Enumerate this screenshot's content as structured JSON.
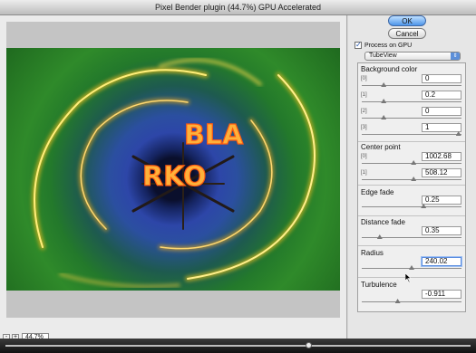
{
  "window": {
    "title": "Pixel Bender plugin (44.7%) GPU Accelerated"
  },
  "buttons": {
    "ok": "OK",
    "cancel": "Cancel"
  },
  "process_on_gpu": {
    "label": "Process on GPU",
    "checked": true
  },
  "filter_select": {
    "value": "TubeView"
  },
  "zoom": {
    "value": "44.7%",
    "minus": "-",
    "plus": "+"
  },
  "preview": {
    "sign_letters_top": "BLA",
    "sign_letters_bottom": "RKO"
  },
  "params": {
    "background_color": {
      "label": "Background color",
      "channels": [
        {
          "index": "[0]",
          "value": "0",
          "level": 0.22
        },
        {
          "index": "[1]",
          "value": "0.2",
          "level": 0.22
        },
        {
          "index": "[2]",
          "value": "0",
          "level": 0.22
        },
        {
          "index": "[3]",
          "value": "1",
          "level": 0.97
        }
      ]
    },
    "center_point": {
      "label": "Center point",
      "channels": [
        {
          "index": "[0]",
          "value": "1002.68",
          "level": 0.52
        },
        {
          "index": "[1]",
          "value": "508.12",
          "level": 0.52
        }
      ]
    },
    "edge_fade": {
      "label": "Edge fade",
      "value": "0.25",
      "level": 0.62
    },
    "distance_fade": {
      "label": "Distance fade",
      "value": "0.35",
      "level": 0.18
    },
    "radius": {
      "label": "Radius",
      "value": "240.02",
      "level": 0.5
    },
    "turbulence": {
      "label": "Turbulence",
      "value": "-0.911",
      "level": 0.36
    }
  },
  "colors": {
    "accent": "#4d95ea",
    "preview_green": "#2f8a2a",
    "preview_blue": "#2d46a8",
    "neon_orange": "#ff7a1a"
  },
  "icons": {
    "checkbox": "check-icon",
    "dropdown": "chevron-updown-icon",
    "cursor": "arrow-cursor-icon"
  }
}
